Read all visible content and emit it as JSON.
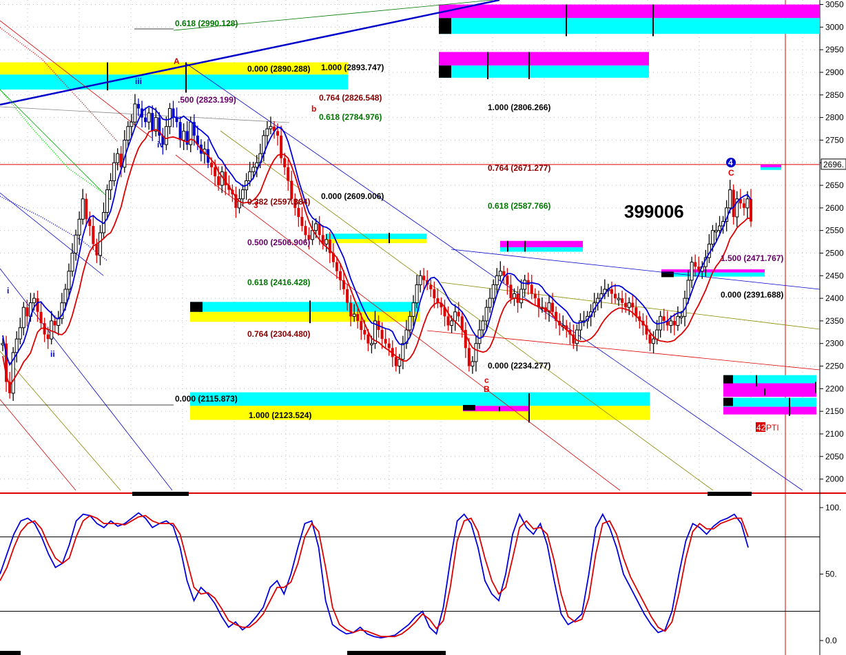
{
  "chart_data": [
    {
      "type": "candlestick",
      "panel": "price",
      "symbol_label": "399006",
      "ylim": [
        1975,
        3060
      ],
      "y_ticks": [
        "3050",
        "3000",
        "2950",
        "2900",
        "2850",
        "2800",
        "2750",
        "2700",
        "2650",
        "2600",
        "2550",
        "2500",
        "2450",
        "2400",
        "2350",
        "2300",
        "2250",
        "2200",
        "2150",
        "2100",
        "2050",
        "2000"
      ],
      "last_price_label": "2696.",
      "pti_label": {
        "number": "42",
        "text": "PTI"
      },
      "series": [
        {
          "name": "close",
          "values": [
            2300,
            2215,
            2190,
            2280,
            2310,
            2335,
            2380,
            2360,
            2390,
            2400,
            2370,
            2345,
            2320,
            2310,
            2350,
            2340,
            2355,
            2390,
            2420,
            2460,
            2500,
            2540,
            2575,
            2620,
            2575,
            2560,
            2520,
            2495,
            2545,
            2590,
            2640,
            2660,
            2700,
            2720,
            2690,
            2750,
            2780,
            2790,
            2830,
            2820,
            2800,
            2790,
            2810,
            2770,
            2800,
            2760,
            2740,
            2780,
            2820,
            2800,
            2790,
            2750,
            2770,
            2740,
            2790,
            2760,
            2740,
            2720,
            2730,
            2700,
            2690,
            2670,
            2650,
            2680,
            2650,
            2640,
            2630,
            2600,
            2620,
            2640,
            2660,
            2680,
            2690,
            2700,
            2720,
            2760,
            2775,
            2780,
            2770,
            2760,
            2710,
            2690,
            2660,
            2620,
            2600,
            2580,
            2560,
            2540,
            2530,
            2550,
            2565,
            2540,
            2520,
            2530,
            2500,
            2480,
            2460,
            2440,
            2420,
            2390,
            2360,
            2365,
            2350,
            2330,
            2320,
            2300,
            2300,
            2350,
            2330,
            2310,
            2300,
            2290,
            2270,
            2250,
            2265,
            2300,
            2330,
            2360,
            2390,
            2430,
            2450,
            2440,
            2430,
            2420,
            2400,
            2390,
            2380,
            2360,
            2340,
            2350,
            2370,
            2360,
            2330,
            2290,
            2250,
            2260,
            2300,
            2330,
            2350,
            2380,
            2400,
            2430,
            2450,
            2460,
            2450,
            2430,
            2400,
            2410,
            2390,
            2420,
            2440,
            2430,
            2410,
            2400,
            2380,
            2380,
            2370,
            2390,
            2370,
            2350,
            2340,
            2340,
            2330,
            2320,
            2300,
            2330,
            2350,
            2350,
            2360,
            2370,
            2390,
            2400,
            2410,
            2420,
            2420,
            2410,
            2400,
            2400,
            2390,
            2380,
            2390,
            2380,
            2360,
            2350,
            2340,
            2320,
            2300,
            2310,
            2330,
            2360,
            2350,
            2340,
            2350,
            2340,
            2360,
            2360,
            2400,
            2440,
            2480,
            2470,
            2460,
            2470,
            2490,
            2520,
            2550,
            2550,
            2560,
            2570,
            2600,
            2640,
            2580,
            2620,
            2610,
            2600,
            2620,
            2570
          ]
        }
      ]
    },
    {
      "type": "line",
      "panel": "oscillator",
      "ylim": [
        0,
        100
      ],
      "y_ticks": [
        "100.",
        "50.",
        "0.0"
      ],
      "reference_lines": [
        78,
        22
      ],
      "series": [
        {
          "name": "",
          "color": "#0000dd",
          "values": [
            50,
            65,
            80,
            90,
            92,
            88,
            78,
            65,
            55,
            58,
            72,
            90,
            95,
            94,
            88,
            85,
            90,
            86,
            88,
            92,
            96,
            92,
            85,
            88,
            90,
            86,
            70,
            45,
            30,
            40,
            35,
            28,
            18,
            10,
            14,
            8,
            12,
            18,
            25,
            40,
            45,
            35,
            50,
            70,
            88,
            90,
            70,
            30,
            12,
            8,
            5,
            6,
            10,
            5,
            3,
            2,
            3,
            4,
            8,
            12,
            18,
            22,
            10,
            5,
            25,
            60,
            90,
            95,
            88,
            70,
            45,
            35,
            30,
            50,
            80,
            95,
            85,
            80,
            88,
            72,
            45,
            20,
            12,
            15,
            20,
            50,
            85,
            95,
            85,
            70,
            50,
            40,
            30,
            20,
            12,
            6,
            8,
            22,
            50,
            75,
            88,
            85,
            80,
            86,
            90,
            92,
            95,
            88,
            70
          ]
        },
        {
          "name": "",
          "color": "#dd0000",
          "values": [
            45,
            55,
            70,
            82,
            88,
            90,
            84,
            72,
            62,
            58,
            62,
            78,
            90,
            94,
            92,
            88,
            88,
            88,
            87,
            90,
            93,
            94,
            90,
            88,
            88,
            88,
            80,
            60,
            40,
            35,
            36,
            32,
            24,
            15,
            12,
            10,
            10,
            14,
            20,
            30,
            40,
            40,
            44,
            58,
            78,
            88,
            82,
            55,
            25,
            12,
            8,
            6,
            8,
            7,
            5,
            3,
            3,
            3,
            5,
            9,
            14,
            20,
            16,
            9,
            15,
            40,
            75,
            90,
            92,
            82,
            62,
            45,
            35,
            40,
            62,
            85,
            90,
            84,
            85,
            80,
            60,
            35,
            18,
            14,
            16,
            32,
            65,
            88,
            90,
            80,
            62,
            48,
            38,
            28,
            18,
            10,
            7,
            14,
            35,
            62,
            82,
            88,
            84,
            84,
            88,
            90,
            92,
            92,
            78
          ]
        }
      ]
    }
  ],
  "annotations": {
    "fib_labels": [
      {
        "text": "0.618 (2990.128)",
        "color": "#007700"
      },
      {
        "text": "0.000 (2890.288)",
        "color": "#000000"
      },
      {
        "text": "1.000 (2893.747)",
        "color": "#000000"
      },
      {
        "text": ".500 (2823.199)",
        "color": "#660066"
      },
      {
        "text": "0.764 (2826.548)",
        "color": "#880000"
      },
      {
        "text": "0.618 (2784.976)",
        "color": "#007700"
      },
      {
        "text": "1.000 (2806.266)",
        "color": "#000000"
      },
      {
        "text": "0.764 (2671.277)",
        "color": "#880000"
      },
      {
        "text": "0.618 (2587.766)",
        "color": "#007700"
      },
      {
        "text": "0.382 (2597.384)",
        "color": "#880000"
      },
      {
        "text": "0.000 (2609.006)",
        "color": "#000000"
      },
      {
        "text": "0.500 (2506.906)",
        "color": "#660066"
      },
      {
        "text": "0.618 (2416.428)",
        "color": "#007700"
      },
      {
        "text": "0.764 (2304.480)",
        "color": "#880000"
      },
      {
        "text": "0.000 (2234.277)",
        "color": "#000000"
      },
      {
        "text": "0.000 (2115.873)",
        "color": "#000000"
      },
      {
        "text": "1.000 (2123.524)",
        "color": "#000000"
      },
      {
        "text": "1.500 (2471.767)",
        "color": "#660066"
      },
      {
        "text": "0.000 (2391.688)",
        "color": "#000000"
      }
    ],
    "wave_labels": {
      "A": "A",
      "b_small": "b",
      "c_small": "c",
      "B": "B",
      "C": "C",
      "four": "4",
      "i": "i",
      "ii": "ii",
      "iii": "iii",
      "iv": "iv",
      "three": "3"
    }
  },
  "colors": {
    "up_bar": "#000000",
    "down_bar_red": "#dd0000",
    "down_bar_blue": "#0000cc",
    "ma_blue": "#0000dd",
    "ma_red": "#dd0000",
    "zone_yellow": "#ffff00",
    "zone_cyan": "#00ffff",
    "zone_magenta": "#ff00ff"
  }
}
